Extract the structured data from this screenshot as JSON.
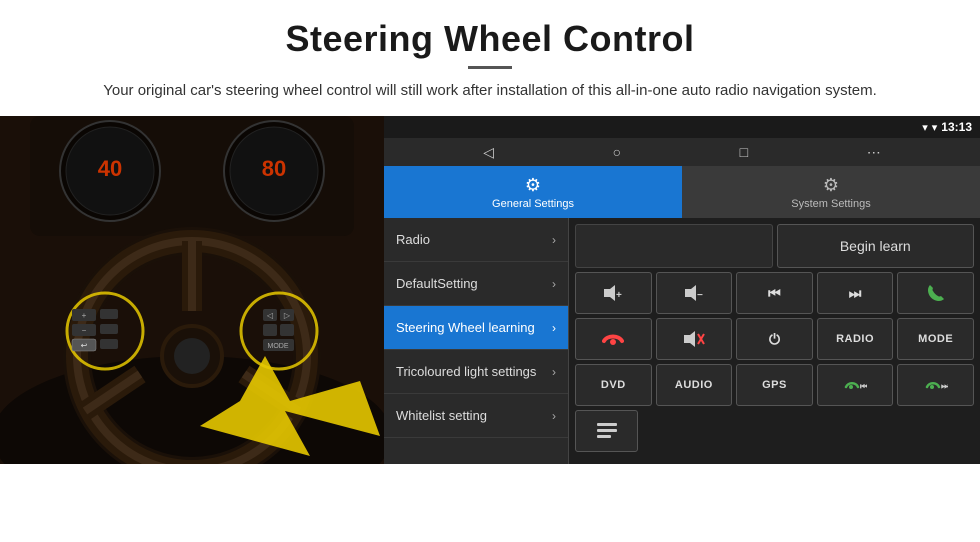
{
  "header": {
    "title": "Steering Wheel Control",
    "subtitle": "Your original car's steering wheel control will still work after installation of this all-in-one auto radio navigation system."
  },
  "statusBar": {
    "time": "13:13"
  },
  "tabs": [
    {
      "id": "general",
      "label": "General Settings",
      "active": true
    },
    {
      "id": "system",
      "label": "System Settings",
      "active": false
    }
  ],
  "menu": {
    "items": [
      {
        "id": "radio",
        "label": "Radio",
        "active": false
      },
      {
        "id": "default",
        "label": "DefaultSetting",
        "active": false
      },
      {
        "id": "steering",
        "label": "Steering Wheel learning",
        "active": true
      },
      {
        "id": "tricoloured",
        "label": "Tricoloured light settings",
        "active": false
      },
      {
        "id": "whitelist",
        "label": "Whitelist setting",
        "active": false
      }
    ]
  },
  "controls": {
    "begin_learn": "Begin learn",
    "buttons_row1": [
      "vol+",
      "vol-",
      "prev",
      "next",
      "phone"
    ],
    "buttons_row2": [
      "hang",
      "mute",
      "power",
      "radio_btn",
      "mode"
    ],
    "buttons_row3": [
      "dvd",
      "audio",
      "gps",
      "prev_call",
      "next_call"
    ],
    "buttons_row4_label": [
      "menu_icon"
    ],
    "labels": {
      "vol_up": "🔊+",
      "vol_down": "🔊-",
      "prev": "⏮",
      "next": "⏭",
      "phone": "📞",
      "hang": "↩",
      "mute": "🔊✕",
      "power": "⏻",
      "radio": "RADIO",
      "mode": "MODE",
      "dvd": "DVD",
      "audio": "AUDIO",
      "gps": "GPS",
      "prev_call": "📞⏮",
      "next_call": "📞⏭"
    }
  }
}
